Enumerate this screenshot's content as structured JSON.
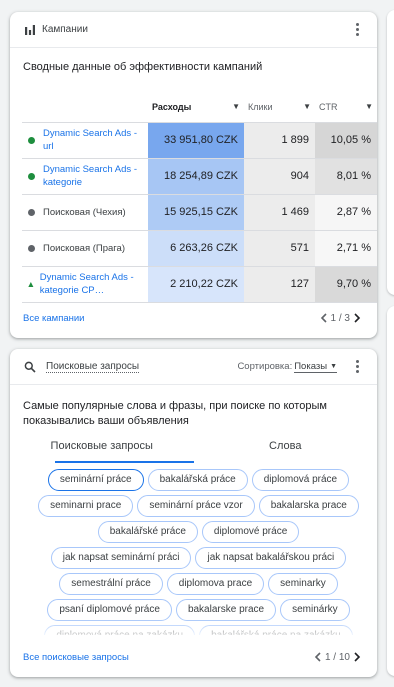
{
  "campaigns_card": {
    "header_label": "Кампании",
    "title": "Сводные данные об эффективности кампаний",
    "columns": {
      "name": "",
      "cost": "Расходы",
      "clicks": "Клики",
      "ctr": "CTR"
    },
    "rows": [
      {
        "name": "Dynamic Search Ads - url",
        "status": "enabled",
        "status_color": "#1e8e3e",
        "is_link": true,
        "cost": "33 951,80 CZK",
        "cost_share": 1.0,
        "clicks": "1 899",
        "ctr": "10,05 %",
        "ctr_shade": "#d6d6d6"
      },
      {
        "name": "Dynamic Search Ads - kategorie",
        "status": "enabled",
        "status_color": "#1e8e3e",
        "is_link": true,
        "cost": "18 254,89 CZK",
        "cost_share": 0.54,
        "clicks": "904",
        "ctr": "8,01 %",
        "ctr_shade": "#e1e1e1"
      },
      {
        "name": "Поисковая (Чехия)",
        "status": "paused",
        "status_color": "#5f6368",
        "is_link": false,
        "cost": "15 925,15 CZK",
        "cost_share": 0.47,
        "clicks": "1 469",
        "ctr": "2,87 %",
        "ctr_shade": "#f6f6f6"
      },
      {
        "name": "Поисковая (Прага)",
        "status": "paused",
        "status_color": "#5f6368",
        "is_link": false,
        "cost": "6 263,26 CZK",
        "cost_share": 0.18,
        "clicks": "571",
        "ctr": "2,71 %",
        "ctr_shade": "#f7f7f7"
      },
      {
        "name": "Dynamic Search Ads - kategorie CP…",
        "status": "limited",
        "status_color": "#1e8e3e",
        "is_link": true,
        "cost": "2 210,22 CZK",
        "cost_share": 0.07,
        "clicks": "127",
        "ctr": "9,70 %",
        "ctr_shade": "#d9d9d9"
      }
    ],
    "footer_link": "Все кампании",
    "pager": "1 / 3"
  },
  "search_card": {
    "header_label": "Поисковые запросы",
    "sort_label": "Сортировка:",
    "sort_value": "Показы",
    "title": "Самые популярные слова и фразы, при поиске по которым показывались ваши объявления",
    "tabs": [
      "Поисковые запросы",
      "Слова"
    ],
    "chips": [
      "seminární práce",
      "bakalářská práce",
      "diplomová práce",
      "seminarni prace",
      "seminární práce vzor",
      "bakalarska prace",
      "bakalářské práce",
      "diplomové práce",
      "jak napsat seminární práci",
      "jak napsat bakalářskou práci",
      "semestrální práce",
      "diplomova prace",
      "seminarky",
      "psaní diplomové práce",
      "bakalarske prace",
      "seminárky",
      "diplomová práce na zakázku",
      "bakalářská práce na zakázku"
    ],
    "footer_link": "Все поисковые запросы",
    "pager": "1 / 10"
  },
  "colors": {
    "accent": "#1a73e8",
    "cost_heat": "#7baaf7",
    "border": "#dadce0"
  }
}
